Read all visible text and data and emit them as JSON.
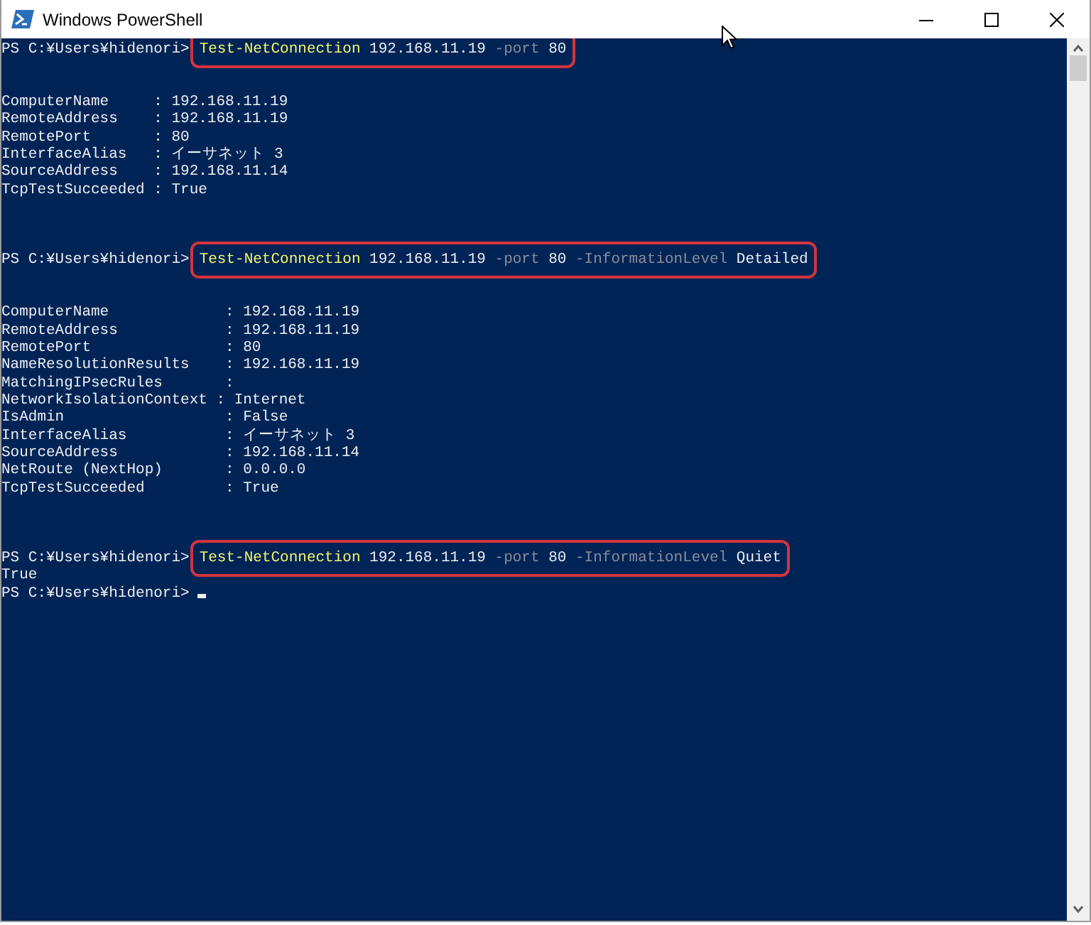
{
  "window": {
    "title": "Windows PowerShell"
  },
  "console": {
    "lines": [
      {
        "kind": "prompt",
        "prompt": "PS C:¥Users¥hidenori>",
        "highlighted": true,
        "cursor": false,
        "tokens": [
          {
            "kind": "cmdlet",
            "text": "Test-NetConnection"
          },
          {
            "kind": "arg",
            "text": "192.168.11.19"
          },
          {
            "kind": "param",
            "text": "-port"
          },
          {
            "kind": "arg",
            "text": "80"
          }
        ]
      },
      {
        "kind": "blank"
      },
      {
        "kind": "blank"
      },
      {
        "kind": "output",
        "text": "ComputerName     : 192.168.11.19"
      },
      {
        "kind": "output",
        "text": "RemoteAddress    : 192.168.11.19"
      },
      {
        "kind": "output",
        "text": "RemotePort       : 80"
      },
      {
        "kind": "output",
        "text": "InterfaceAlias   : イーサネット 3"
      },
      {
        "kind": "output",
        "text": "SourceAddress    : 192.168.11.14"
      },
      {
        "kind": "output",
        "text": "TcpTestSucceeded : True"
      },
      {
        "kind": "blank"
      },
      {
        "kind": "blank"
      },
      {
        "kind": "blank"
      },
      {
        "kind": "prompt",
        "prompt": "PS C:¥Users¥hidenori>",
        "highlighted": true,
        "cursor": false,
        "tokens": [
          {
            "kind": "cmdlet",
            "text": "Test-NetConnection"
          },
          {
            "kind": "arg",
            "text": "192.168.11.19"
          },
          {
            "kind": "param",
            "text": "-port"
          },
          {
            "kind": "arg",
            "text": "80"
          },
          {
            "kind": "param",
            "text": "-InformationLevel"
          },
          {
            "kind": "arg",
            "text": "Detailed"
          }
        ]
      },
      {
        "kind": "blank"
      },
      {
        "kind": "blank"
      },
      {
        "kind": "output",
        "text": "ComputerName             : 192.168.11.19"
      },
      {
        "kind": "output",
        "text": "RemoteAddress            : 192.168.11.19"
      },
      {
        "kind": "output",
        "text": "RemotePort               : 80"
      },
      {
        "kind": "output",
        "text": "NameResolutionResults    : 192.168.11.19"
      },
      {
        "kind": "output",
        "text": "MatchingIPsecRules       :"
      },
      {
        "kind": "output",
        "text": "NetworkIsolationContext : Internet"
      },
      {
        "kind": "output",
        "text": "IsAdmin                  : False"
      },
      {
        "kind": "output",
        "text": "InterfaceAlias           : イーサネット 3"
      },
      {
        "kind": "output",
        "text": "SourceAddress            : 192.168.11.14"
      },
      {
        "kind": "output",
        "text": "NetRoute (NextHop)       : 0.0.0.0"
      },
      {
        "kind": "output",
        "text": "TcpTestSucceeded         : True"
      },
      {
        "kind": "blank"
      },
      {
        "kind": "blank"
      },
      {
        "kind": "blank"
      },
      {
        "kind": "prompt",
        "prompt": "PS C:¥Users¥hidenori>",
        "highlighted": true,
        "cursor": false,
        "tokens": [
          {
            "kind": "cmdlet",
            "text": "Test-NetConnection"
          },
          {
            "kind": "arg",
            "text": "192.168.11.19"
          },
          {
            "kind": "param",
            "text": "-port"
          },
          {
            "kind": "arg",
            "text": "80"
          },
          {
            "kind": "param",
            "text": "-InformationLevel"
          },
          {
            "kind": "arg",
            "text": "Quiet"
          }
        ]
      },
      {
        "kind": "output",
        "text": "True"
      },
      {
        "kind": "prompt",
        "prompt": "PS C:¥Users¥hidenori>",
        "highlighted": false,
        "cursor": true
      }
    ]
  }
}
